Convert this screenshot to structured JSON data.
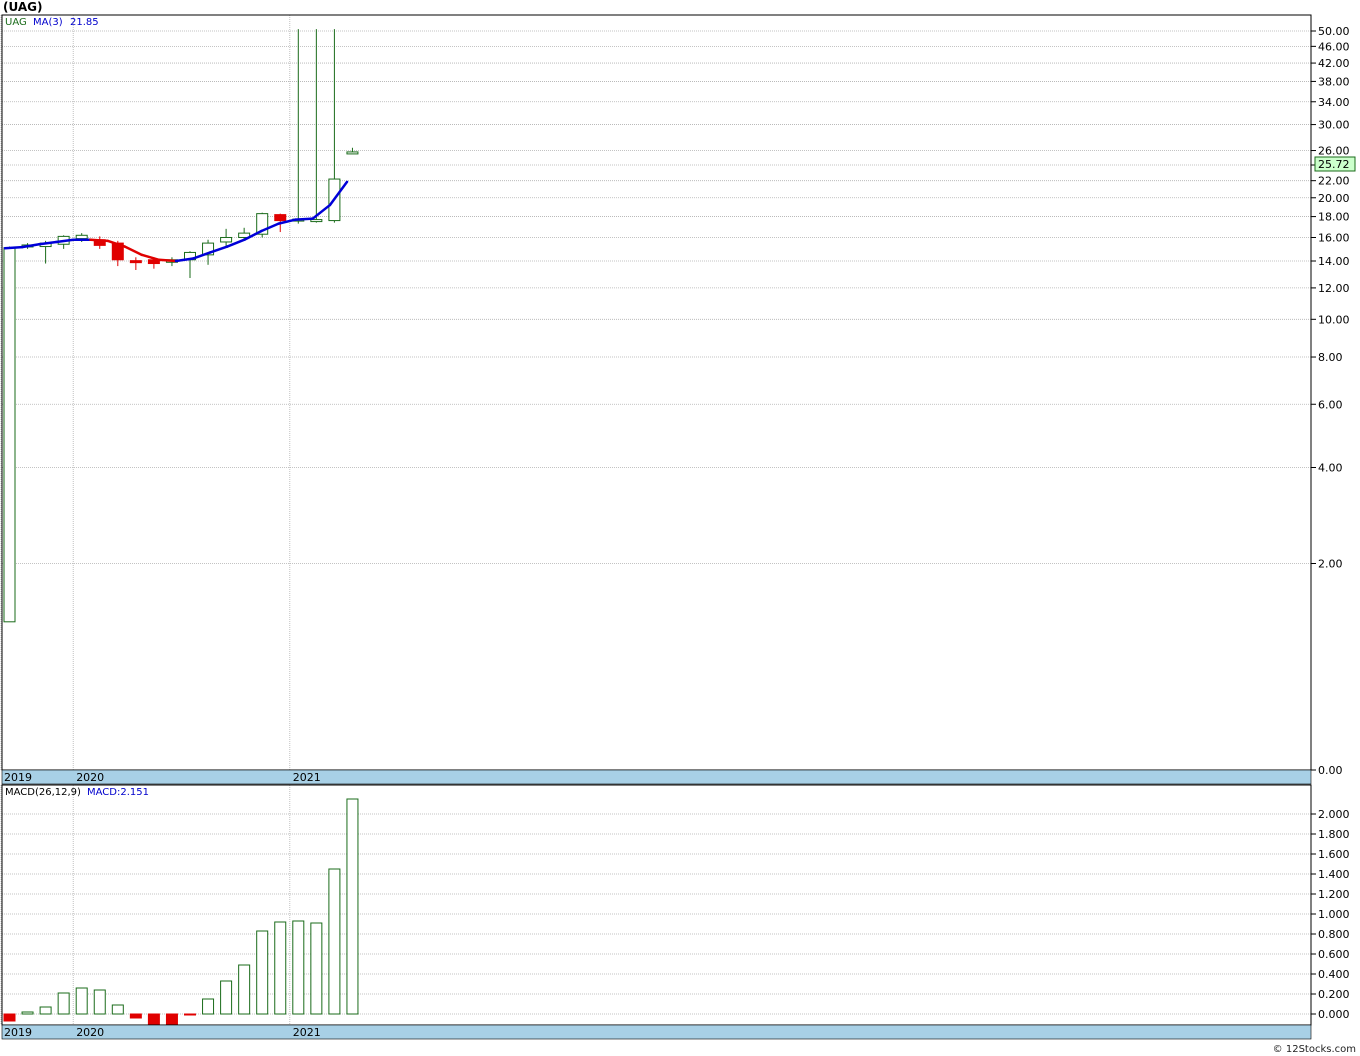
{
  "header": {
    "title": "(UAG)"
  },
  "footer": {
    "credit": "© 12Stocks.com"
  },
  "chart_data": [
    {
      "type": "candlestick",
      "symbol": "UAG",
      "legend": {
        "symbol_label": "UAG",
        "ma_label": "MA(3)",
        "ma_value": "21.85"
      },
      "last_price_label": "25.72",
      "y_scale": "log",
      "y_ticks": [
        "0.00",
        "2.00",
        "4.00",
        "6.00",
        "8.00",
        "10.00",
        "12.00",
        "14.00",
        "16.00",
        "18.00",
        "20.00",
        "22.00",
        "24.00",
        "26.00",
        "30.00",
        "34.00",
        "38.00",
        "42.00",
        "46.00",
        "50.00"
      ],
      "x_ticks": [
        {
          "label": "2019",
          "index": 0
        },
        {
          "label": "2020",
          "index": 4
        },
        {
          "label": "2021",
          "index": 16
        }
      ],
      "grid": true,
      "candles": [
        {
          "open": 1.2,
          "high": 15.2,
          "low": 1.2,
          "close": 15.1
        },
        {
          "open": 15.2,
          "high": 15.5,
          "low": 15.0,
          "close": 15.3
        },
        {
          "open": 15.2,
          "high": 15.7,
          "low": 13.8,
          "close": 15.5
        },
        {
          "open": 15.4,
          "high": 16.2,
          "low": 15.0,
          "close": 16.1
        },
        {
          "open": 15.9,
          "high": 16.4,
          "low": 15.6,
          "close": 16.2
        },
        {
          "open": 15.8,
          "high": 16.1,
          "low": 15.0,
          "close": 15.3
        },
        {
          "open": 15.5,
          "high": 15.7,
          "low": 13.6,
          "close": 14.1
        },
        {
          "open": 14.0,
          "high": 14.3,
          "low": 13.3,
          "close": 13.9
        },
        {
          "open": 14.1,
          "high": 14.3,
          "low": 13.4,
          "close": 13.8
        },
        {
          "open": 13.9,
          "high": 14.3,
          "low": 13.6,
          "close": 14.1
        },
        {
          "open": 14.1,
          "high": 14.8,
          "low": 12.7,
          "close": 14.7
        },
        {
          "open": 14.5,
          "high": 15.8,
          "low": 13.7,
          "close": 15.5
        },
        {
          "open": 15.6,
          "high": 16.8,
          "low": 15.2,
          "close": 16.0
        },
        {
          "open": 16.0,
          "high": 16.9,
          "low": 15.8,
          "close": 16.4
        },
        {
          "open": 16.3,
          "high": 18.4,
          "low": 16.0,
          "close": 18.3
        },
        {
          "open": 18.2,
          "high": 18.3,
          "low": 16.5,
          "close": 17.6
        },
        {
          "open": 17.6,
          "high": 50.5,
          "low": 17.3,
          "close": 17.7
        },
        {
          "open": 17.6,
          "high": 50.5,
          "low": 17.4,
          "close": 17.6
        },
        {
          "open": 17.6,
          "high": 50.5,
          "low": 17.4,
          "close": 22.2
        },
        {
          "open": 25.6,
          "high": 26.4,
          "low": 25.5,
          "close": 25.72
        }
      ],
      "ma_values": [
        15.05,
        15.15,
        15.4,
        15.6,
        15.8,
        15.8,
        15.7,
        15.2,
        14.5,
        14.1,
        14.0,
        14.2,
        14.7,
        15.2,
        15.8,
        16.6,
        17.3,
        17.7,
        17.8,
        19.2,
        21.85
      ]
    },
    {
      "type": "bar",
      "legend": {
        "macd_label": "MACD(26,12,9)",
        "macd_value": "MACD:2.151"
      },
      "y_ticks": [
        "0.000",
        "0.200",
        "0.400",
        "0.600",
        "0.800",
        "1.000",
        "1.200",
        "1.400",
        "1.600",
        "1.800",
        "2.000"
      ],
      "ylim": [
        -0.1,
        2.2
      ],
      "x_ticks": [
        {
          "label": "2019",
          "index": 0
        },
        {
          "label": "2020",
          "index": 4
        },
        {
          "label": "2021",
          "index": 16
        }
      ],
      "values": [
        -0.07,
        0.02,
        0.07,
        0.21,
        0.26,
        0.24,
        0.09,
        -0.04,
        -0.1,
        -0.1,
        -0.01,
        0.15,
        0.33,
        0.49,
        0.83,
        0.92,
        0.93,
        0.91,
        1.45,
        2.15
      ]
    }
  ],
  "colors": {
    "up": "#1a6b1a",
    "down": "#e00000",
    "ma_up": "#0000d8",
    "ma_down": "#e00000",
    "axis_band": "#a8d0e6",
    "grid": "#b0b0b0",
    "last_price_bg": "#ccffcc"
  }
}
